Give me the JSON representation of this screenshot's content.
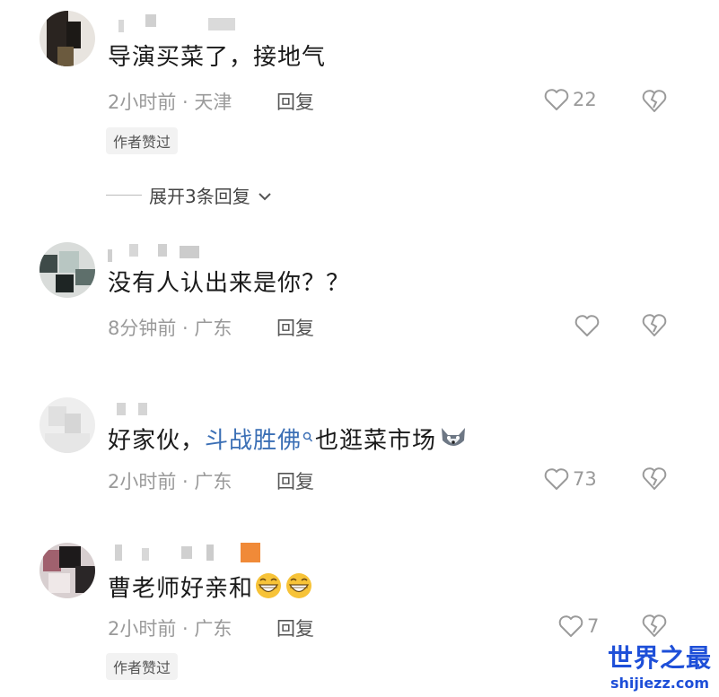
{
  "comments": [
    {
      "text": "导演买菜了，接地气",
      "time": "2小时前",
      "location": "天津",
      "reply_label": "回复",
      "like_count": "22",
      "badge": "作者赞过"
    },
    {
      "text": "没有人认出来是你？？",
      "time": "8分钟前",
      "location": "广东",
      "reply_label": "回复",
      "like_count": ""
    },
    {
      "text_before": "好家伙，",
      "link": "斗战胜佛",
      "text_after": "也逛菜市场",
      "time": "2小时前",
      "location": "广东",
      "reply_label": "回复",
      "like_count": "73"
    },
    {
      "text": "曹老师好亲和",
      "time": "2小时前",
      "location": "广东",
      "reply_label": "回复",
      "like_count": "7",
      "badge": "作者赞过"
    }
  ],
  "expand_replies": "展开3条回复",
  "meta_sep": " · ",
  "icons": {
    "like": "heart-outline-icon",
    "dislike": "broken-heart-icon",
    "search": "search-icon",
    "expand": "chevron-down-icon",
    "wolf_emoji": "wolf-emoji-icon",
    "grin_emoji": "grinning-emoji-icon"
  },
  "watermark": {
    "title": "世界之最",
    "url": "shijiezz.com"
  }
}
